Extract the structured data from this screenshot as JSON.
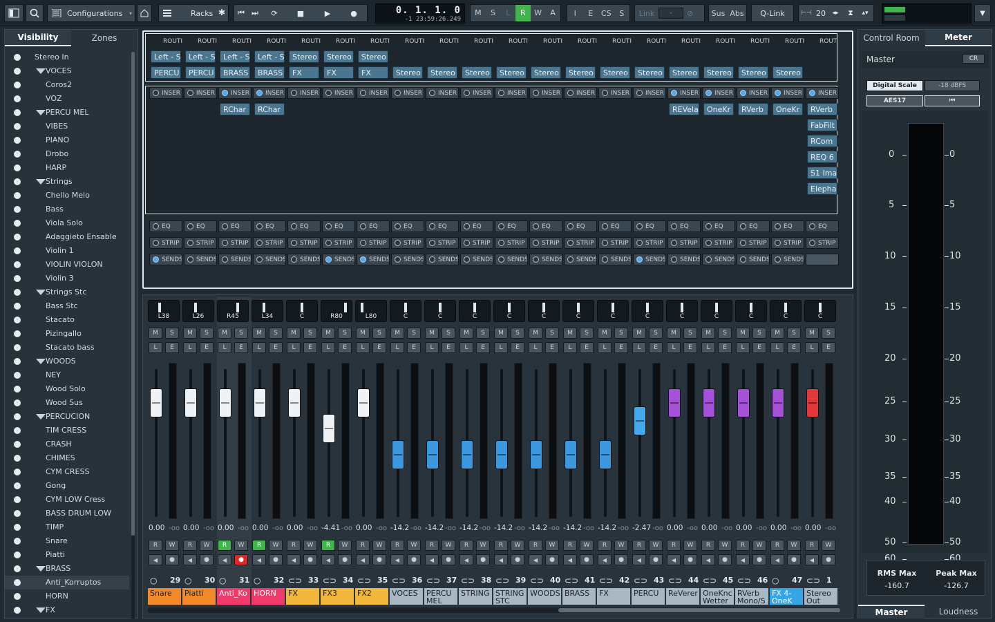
{
  "toolbar": {
    "configurations": "Configurations",
    "racks": "Racks",
    "modes": [
      "M",
      "S",
      "L",
      "R",
      "W",
      "A"
    ],
    "modes2": [
      "I",
      "E",
      "CS",
      "S"
    ],
    "link": "Link",
    "link_value": "-",
    "sus": "Sus",
    "abs": "Abs",
    "qlink": "Q-Link",
    "zoom": "20",
    "time_main": "0.  1.  1.     0",
    "time_sub": "-1  23:59:26.249"
  },
  "left_panel": {
    "tabs": [
      "Visibility",
      "Zones"
    ],
    "items": [
      {
        "label": "Stereo In",
        "level": 0,
        "folder": false
      },
      {
        "label": "VOCES",
        "level": 0,
        "folder": true
      },
      {
        "label": "Coros2",
        "level": 1,
        "folder": false
      },
      {
        "label": "VOZ",
        "level": 1,
        "folder": false
      },
      {
        "label": "PERCU MEL",
        "level": 0,
        "folder": true
      },
      {
        "label": "VIBES",
        "level": 1,
        "folder": false
      },
      {
        "label": "PIANO",
        "level": 1,
        "folder": false
      },
      {
        "label": "Drobo",
        "level": 1,
        "folder": false
      },
      {
        "label": "HARP",
        "level": 1,
        "folder": false
      },
      {
        "label": "Strings",
        "level": 0,
        "folder": true
      },
      {
        "label": "Chello Melo",
        "level": 1,
        "folder": false
      },
      {
        "label": "Bass",
        "level": 1,
        "folder": false
      },
      {
        "label": "Viola Solo",
        "level": 1,
        "folder": false
      },
      {
        "label": "Adaggieto Ensable",
        "level": 1,
        "folder": false
      },
      {
        "label": "Violin 1",
        "level": 1,
        "folder": false
      },
      {
        "label": "VIOLIN VIOLON",
        "level": 1,
        "folder": false
      },
      {
        "label": "Violin 3",
        "level": 1,
        "folder": false
      },
      {
        "label": "Strings Stc",
        "level": 0,
        "folder": true
      },
      {
        "label": "Bass Stc",
        "level": 1,
        "folder": false
      },
      {
        "label": "Stacato",
        "level": 1,
        "folder": false
      },
      {
        "label": "Pizingallo",
        "level": 1,
        "folder": false
      },
      {
        "label": "Stacato bass",
        "level": 1,
        "folder": false
      },
      {
        "label": "WOODS",
        "level": 0,
        "folder": true
      },
      {
        "label": "NEY",
        "level": 1,
        "folder": false
      },
      {
        "label": "Wood Solo",
        "level": 1,
        "folder": false
      },
      {
        "label": "Wood Sus",
        "level": 1,
        "folder": false
      },
      {
        "label": "PERCUCION",
        "level": 0,
        "folder": true
      },
      {
        "label": "TIM CRESS",
        "level": 1,
        "folder": false
      },
      {
        "label": "CRASH",
        "level": 1,
        "folder": false
      },
      {
        "label": "CHIMES",
        "level": 1,
        "folder": false
      },
      {
        "label": "CYM CRESS",
        "level": 1,
        "folder": false
      },
      {
        "label": "Gong",
        "level": 1,
        "folder": false
      },
      {
        "label": "CYM LOW Cress",
        "level": 1,
        "folder": false
      },
      {
        "label": "BASS DRUM LOW",
        "level": 1,
        "folder": false
      },
      {
        "label": "TIMP",
        "level": 1,
        "folder": false
      },
      {
        "label": "Snare",
        "level": 1,
        "folder": false
      },
      {
        "label": "Piatti",
        "level": 1,
        "folder": false
      },
      {
        "label": "BRASS",
        "level": 0,
        "folder": true
      },
      {
        "label": "Anti_Korruptos",
        "level": 1,
        "folder": false
      },
      {
        "label": "HORN",
        "level": 1,
        "folder": false
      },
      {
        "label": "FX",
        "level": 0,
        "folder": true
      }
    ]
  },
  "racks": {
    "routing_label": "ROUTI",
    "routing_last": "ROUT",
    "inputs": [
      "Left - S",
      "Left - S",
      "Left - S",
      "Left - S",
      "Stereo",
      "Stereo",
      "Stereo",
      "",
      "",
      "",
      "",
      "",
      "",
      "",
      "",
      "",
      "",
      "",
      "",
      ""
    ],
    "outputs": [
      "PERCU",
      "PERCU",
      "BRASS",
      "BRASS",
      "FX",
      "FX",
      "FX",
      "Stereo",
      "Stereo",
      "Stereo",
      "Stereo",
      "Stereo",
      "Stereo",
      "Stereo",
      "Stereo",
      "Stereo",
      "Stereo",
      "Stereo",
      "Stereo",
      ""
    ],
    "insert_label": "INSER",
    "insert_on": [
      false,
      false,
      true,
      true,
      false,
      false,
      false,
      false,
      false,
      false,
      false,
      false,
      false,
      false,
      false,
      true,
      true,
      true,
      true,
      true
    ],
    "inserts": [
      {
        "col": 2,
        "names": [
          "RChar"
        ]
      },
      {
        "col": 3,
        "names": [
          "RChar"
        ]
      },
      {
        "col": 15,
        "names": [
          "REVela"
        ]
      },
      {
        "col": 16,
        "names": [
          "OneKr"
        ]
      },
      {
        "col": 17,
        "names": [
          "RVerb"
        ]
      },
      {
        "col": 18,
        "names": [
          "OneKr"
        ]
      },
      {
        "col": 19,
        "names": [
          "RVerb",
          "FabFilt",
          "RCom",
          "REQ 6",
          "S1 Ima",
          "Elepha"
        ]
      }
    ],
    "eq_label": "EQ",
    "strip_label": "STRIP",
    "sends_label": "SENDS",
    "sends_on": [
      true,
      false,
      false,
      false,
      false,
      true,
      true,
      false,
      false,
      false,
      false,
      false,
      false,
      false,
      true,
      false,
      false,
      false,
      false
    ]
  },
  "mixer": {
    "channels": [
      {
        "pan": "L38",
        "vol": "0.00",
        "peak": "-oo",
        "num": "29",
        "name": "Snare",
        "color": "#f28a2c",
        "fader": 0.77,
        "faderColor": "white",
        "R": false,
        "W": false,
        "rec": false,
        "link": false
      },
      {
        "pan": "L26",
        "vol": "0.00",
        "peak": "-oo",
        "num": "30",
        "name": "Piatti",
        "color": "#f28a2c",
        "fader": 0.77,
        "faderColor": "white",
        "R": false,
        "W": false,
        "rec": false,
        "link": false
      },
      {
        "pan": "R45",
        "vol": "0.00",
        "peak": "-oo",
        "num": "31",
        "name": "Anti_Ko",
        "color": "#ef3a6a",
        "fader": 0.77,
        "faderColor": "white",
        "R": true,
        "W": false,
        "rec": true,
        "link": false
      },
      {
        "pan": "L34",
        "vol": "0.00",
        "peak": "-oo",
        "num": "32",
        "name": "HORN",
        "color": "#ef3a6a",
        "fader": 0.77,
        "faderColor": "white",
        "R": true,
        "W": false,
        "rec": false,
        "link": false
      },
      {
        "pan": "C",
        "vol": "0.00",
        "peak": "-oo",
        "num": "33",
        "name": "FX",
        "color": "#f2b73a",
        "fader": 0.77,
        "faderColor": "white",
        "R": false,
        "W": false,
        "rec": false,
        "link": true
      },
      {
        "pan": "R80",
        "vol": "-4.41",
        "peak": "-oo",
        "num": "34",
        "name": "FX3",
        "color": "#f2b73a",
        "fader": 0.6,
        "faderColor": "white",
        "R": true,
        "W": false,
        "rec": false,
        "link": true
      },
      {
        "pan": "L80",
        "vol": "0.00",
        "peak": "-oo",
        "num": "35",
        "name": "FX2",
        "color": "#f2b73a",
        "fader": 0.77,
        "faderColor": "white",
        "R": false,
        "W": false,
        "rec": false,
        "link": true
      },
      {
        "pan": "C",
        "vol": "-14.2",
        "peak": "-oo",
        "num": "36",
        "name": "VOCES",
        "color": "#a7b7c4",
        "fader": 0.42,
        "faderColor": "blue",
        "R": false,
        "W": false,
        "rec": false,
        "link": true
      },
      {
        "pan": "C",
        "vol": "-14.2",
        "peak": "-oo",
        "num": "37",
        "name": "PERCU MEL",
        "color": "#a7b7c4",
        "fader": 0.42,
        "faderColor": "blue",
        "R": false,
        "W": false,
        "rec": false,
        "link": true
      },
      {
        "pan": "C",
        "vol": "-14.2",
        "peak": "-oo",
        "num": "38",
        "name": "STRING",
        "color": "#a7b7c4",
        "fader": 0.42,
        "faderColor": "blue",
        "R": false,
        "W": false,
        "rec": false,
        "link": true
      },
      {
        "pan": "C",
        "vol": "-14.2",
        "peak": "-oo",
        "num": "39",
        "name": "STRING STC",
        "color": "#a7b7c4",
        "fader": 0.42,
        "faderColor": "blue",
        "R": false,
        "W": false,
        "rec": false,
        "link": true
      },
      {
        "pan": "C",
        "vol": "-14.2",
        "peak": "-oo",
        "num": "40",
        "name": "WOODS",
        "color": "#a7b7c4",
        "fader": 0.42,
        "faderColor": "blue",
        "R": false,
        "W": false,
        "rec": false,
        "link": true
      },
      {
        "pan": "C",
        "vol": "-14.2",
        "peak": "-oo",
        "num": "41",
        "name": "BRASS",
        "color": "#a7b7c4",
        "fader": 0.42,
        "faderColor": "blue",
        "R": false,
        "W": false,
        "rec": false,
        "link": true
      },
      {
        "pan": "C",
        "vol": "-14.2",
        "peak": "-oo",
        "num": "42",
        "name": "FX",
        "color": "#a7b7c4",
        "fader": 0.42,
        "faderColor": "blue",
        "R": false,
        "W": false,
        "rec": false,
        "link": true
      },
      {
        "pan": "C",
        "vol": "-2.47",
        "peak": "-oo",
        "num": "43",
        "name": "PERCU",
        "color": "#a7b7c4",
        "fader": 0.65,
        "faderColor": "lightblue",
        "R": false,
        "W": false,
        "rec": false,
        "link": true
      },
      {
        "pan": "C",
        "vol": "0.00",
        "peak": "-oo",
        "num": "44",
        "name": "ReVerer",
        "color": "#a7b7c4",
        "fader": 0.77,
        "faderColor": "purple",
        "R": false,
        "W": false,
        "rec": false,
        "link": true
      },
      {
        "pan": "C",
        "vol": "0.00",
        "peak": "-oo",
        "num": "45",
        "name": "OneKnc Wetter",
        "color": "#a7b7c4",
        "fader": 0.77,
        "faderColor": "purple",
        "R": false,
        "W": false,
        "rec": false,
        "link": true
      },
      {
        "pan": "C",
        "vol": "0.00",
        "peak": "-oo",
        "num": "46",
        "name": "RVerb Mono/S",
        "color": "#a7b7c4",
        "fader": 0.77,
        "faderColor": "purple",
        "R": false,
        "W": false,
        "rec": false,
        "link": true
      },
      {
        "pan": "C",
        "vol": "0.00",
        "peak": "-oo",
        "num": "47",
        "name": "FX 4-OneK",
        "color": "#34a6e8",
        "fader": 0.77,
        "faderColor": "purple",
        "R": false,
        "W": false,
        "rec": false,
        "link": false
      },
      {
        "pan": "C",
        "vol": "0.00",
        "peak": "-oo",
        "num": "1",
        "name": "Stereo Out",
        "color": "#a7b7c4",
        "fader": 0.77,
        "faderColor": "red",
        "R": false,
        "W": false,
        "rec": false,
        "link": true
      }
    ]
  },
  "right_panel": {
    "tabs": [
      "Control Room",
      "Meter"
    ],
    "master_label": "Master",
    "cr_label": "CR",
    "digital_scale": "Digital Scale",
    "dbfs": "-18 dBFS",
    "aes": "AES17",
    "reset_icon": "skip-back-icon",
    "scale": [
      "0",
      "5",
      "10",
      "15",
      "20",
      "25",
      "30",
      "35",
      "40",
      "50",
      "60"
    ],
    "rms_label": "RMS Max",
    "rms_value": "-160.7",
    "peak_label": "Peak Max",
    "peak_value": "-126.7",
    "bottom_tabs": [
      "Master",
      "Loudness"
    ]
  },
  "colors": {
    "accent_green": "#3fb54a",
    "accent_blue": "#3fa0e0",
    "rec_red": "#e32626"
  }
}
